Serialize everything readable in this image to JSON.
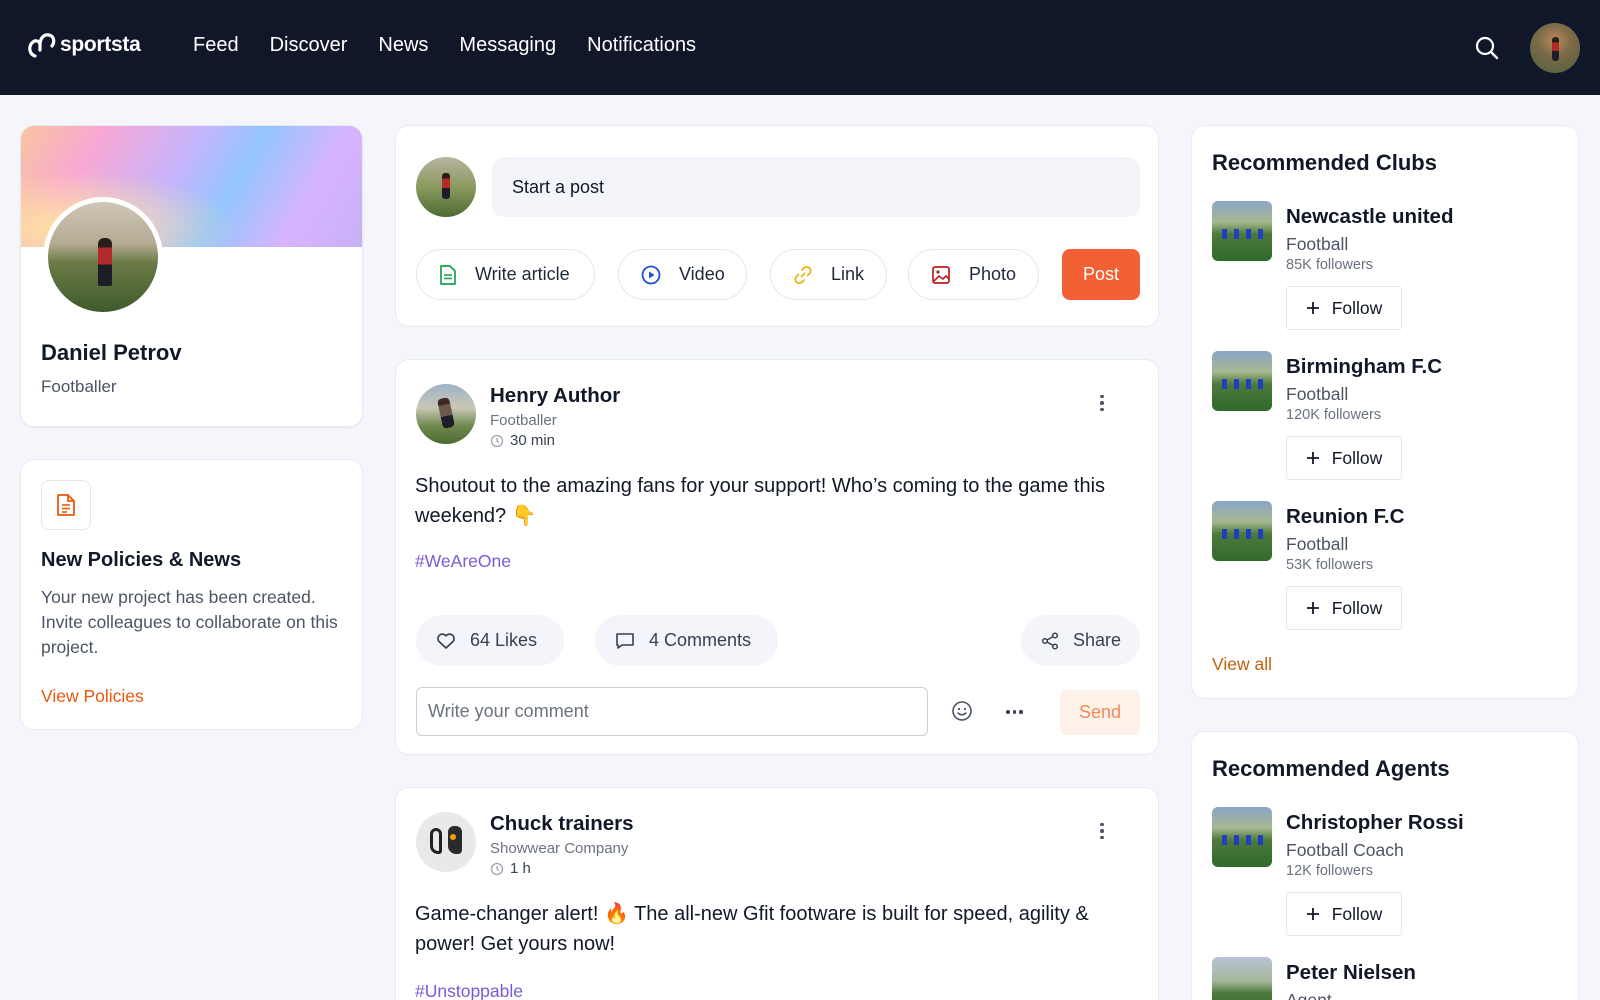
{
  "app": {
    "brand": "sportsta"
  },
  "nav": {
    "items": [
      "Feed",
      "Discover",
      "News",
      "Messaging",
      "Notifications"
    ]
  },
  "profile": {
    "name": "Daniel Petrov",
    "role": "Footballer"
  },
  "policies": {
    "title": "New Policies & News",
    "body": "Your new project has been created. Invite colleagues to collaborate on this project.",
    "link": "View Policies"
  },
  "composer": {
    "placeholder": "Start a post",
    "actions": [
      "Write article",
      "Video",
      "Link",
      "Photo"
    ],
    "post_label": "Post"
  },
  "posts": [
    {
      "author": "Henry Author",
      "subtitle": "Footballer",
      "time": "30 min",
      "text": "Shoutout to the amazing fans for your support! Who’s coming to the game this weekend? 👇",
      "tag": "#WeAreOne",
      "likes": "64 Likes",
      "comments": "4 Comments",
      "share": "Share",
      "comment_placeholder": "Write your comment",
      "send": "Send"
    },
    {
      "author": "Chuck trainers",
      "subtitle": "Showwear Company",
      "time": "1 h",
      "text": "Game-changer alert! 🔥  The all-new Gfit footware is built for speed, agility & power! Get yours now!",
      "tag": "#Unstoppable"
    }
  ],
  "recommended_clubs": {
    "title": "Recommended Clubs",
    "items": [
      {
        "name": "Newcastle united",
        "type": "Football",
        "followers": "85K followers"
      },
      {
        "name": "Birmingham F.C",
        "type": "Football",
        "followers": "120K followers"
      },
      {
        "name": "Reunion F.C",
        "type": "Football",
        "followers": "53K followers"
      }
    ],
    "follow_label": "Follow",
    "view_all": "View all"
  },
  "recommended_agents": {
    "title": "Recommended Agents",
    "items": [
      {
        "name": "Christopher Rossi",
        "type": "Football Coach",
        "followers": "12K followers"
      },
      {
        "name": "Peter Nielsen",
        "type": "Agent"
      }
    ],
    "follow_label": "Follow"
  },
  "colors": {
    "nav_bg": "#0f1729",
    "accent": "#f26134",
    "link": "#c2620f",
    "hashtag": "#7c5ad6"
  }
}
